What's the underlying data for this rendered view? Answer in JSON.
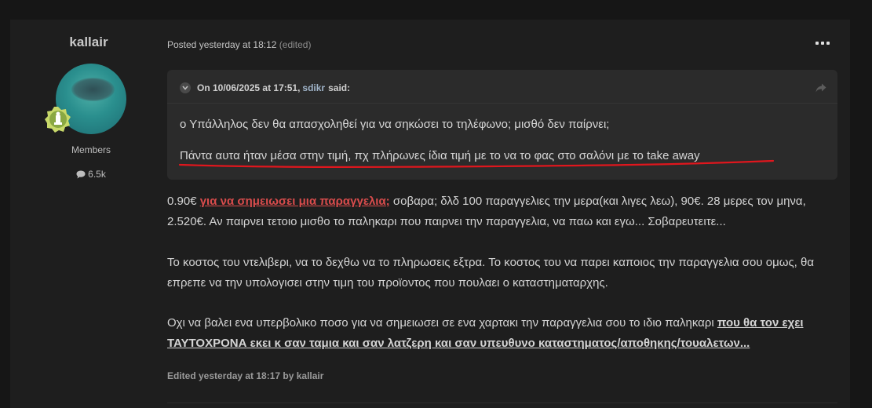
{
  "author": {
    "name": "kallair",
    "group": "Members",
    "reputation": "6.5k"
  },
  "post": {
    "posted_label": "Posted yesterday at 18:12",
    "edited_label": "(edited)",
    "edited_footer": "Edited yesterday at 18:17 by kallair"
  },
  "quote": {
    "header_prefix": "On 10/06/2025 at 17:51,",
    "user": "sdikr",
    "header_suffix": "said:",
    "line1": "ο Υπάλληλος δεν θα απασχοληθεί για να σηκώσει το τηλέφωνο;  μισθό δεν παίρνει;",
    "line2": "Πάντα αυτα ήταν μέσα στην τιμή, πχ πλήρωνες ίδια τιμή με το να το φας στο σαλόνι με το take away"
  },
  "paragraphs": {
    "p1_a": "0.90€ ",
    "p1_link": "για να σημειωσει μια παραγγελια;",
    "p1_b": " σοβαρα; δλδ 100 παραγγελιες την μερα(και λιγες λεω), 90€. 28 μερες τον μηνα, 2.520€. Αν παιρνει τετοιο μισθο το παληκαρι που παιρνει την παραγγελια, να παω και εγω... Σοβαρευτειτε...",
    "p2": "Το κοστος του ντελιβερι, να το δεχθω να το πληρωσεις εξτρα. Το κοστος του να παρει καποιος την παραγγελια σου ομως, θα επρεπε να την υπολογισει στην τιμη του προϊοντος που πουλαει ο καταστηματαρχης.",
    "p3_a": "Οχι να βαλει ενα υπερβολικο ποσο για να σημειωσει σε ενα χαρτακι την παραγγελια σου το ιδιο παληκαρι ",
    "p3_link": "που θα τον εχει ΤΑΥΤΟΧΡΟΝΑ εκει κ σαν ταμια και σαν λατζερη και σαν υπευθυνο καταστηματος/αποθηκης/τουαλετων..."
  },
  "colors": {
    "background": "#161616",
    "card": "#1e1e1e",
    "quote_bg": "#2b2b2b",
    "red_link": "#d94c4c",
    "annotation_red": "#e0161d"
  }
}
